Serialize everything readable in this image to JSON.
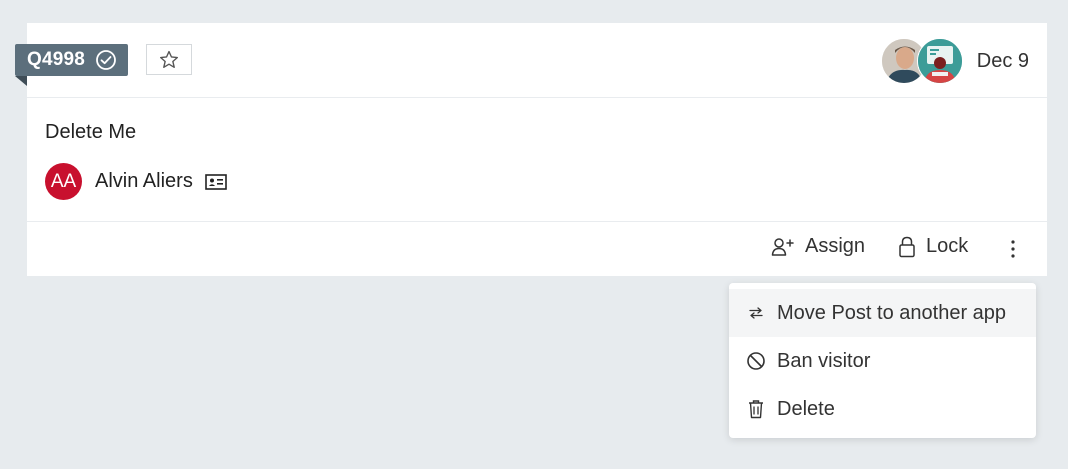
{
  "ticket": {
    "id": "Q4998",
    "date": "Dec 9",
    "subject": "Delete Me",
    "author": {
      "name": "Alvin Aliers",
      "initials": "AA",
      "avatar_color": "#c8102e"
    }
  },
  "footer": {
    "assign_label": "Assign",
    "lock_label": "Lock"
  },
  "menu": {
    "items": [
      {
        "label": "Move Post to another app",
        "icon": "swap-arrows-icon"
      },
      {
        "label": "Ban visitor",
        "icon": "ban-icon"
      },
      {
        "label": "Delete",
        "icon": "trash-icon"
      }
    ]
  },
  "colors": {
    "tag_bg": "#5c6f7c",
    "background": "#e7ebee"
  }
}
